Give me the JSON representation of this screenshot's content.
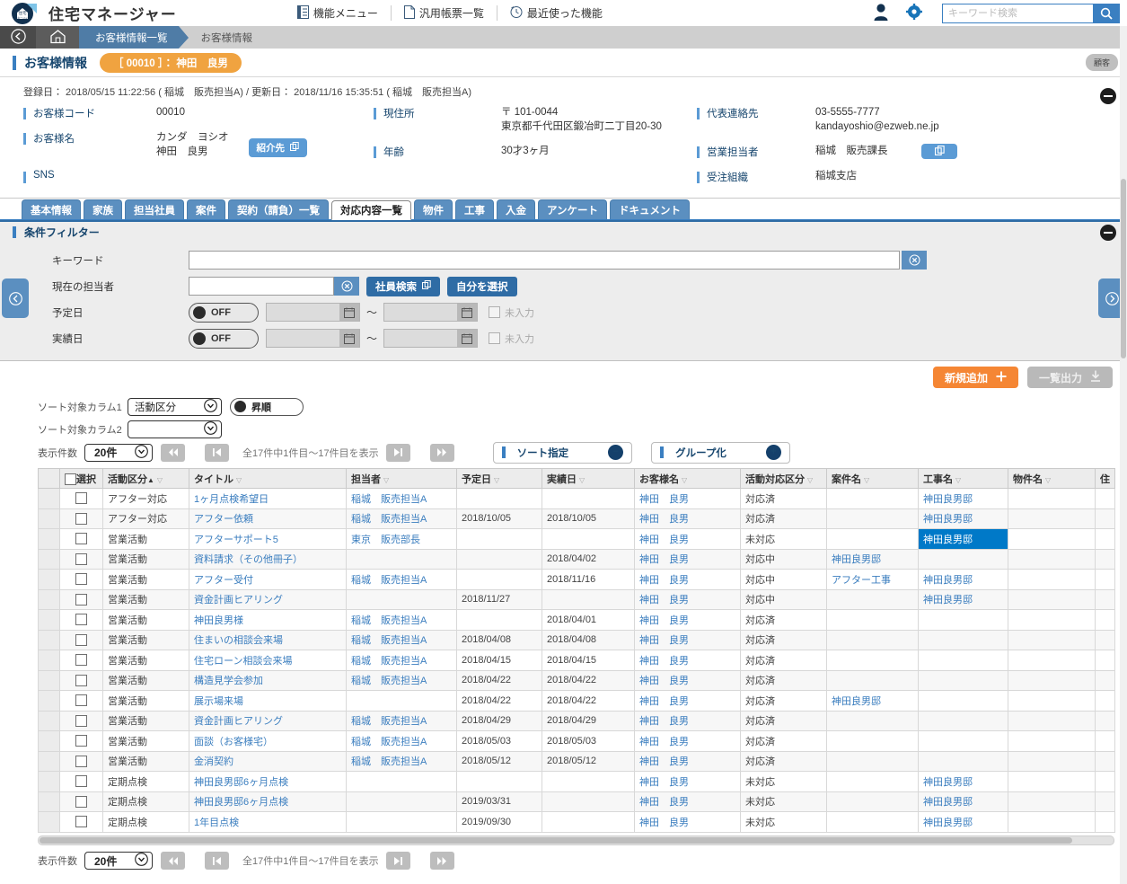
{
  "app": {
    "title": "住宅マネージャー",
    "logo_text": "住宅"
  },
  "header": {
    "menus": [
      {
        "label": "機能メニュー",
        "icon": "document-list-icon"
      },
      {
        "label": "汎用帳票一覧",
        "icon": "file-icon"
      },
      {
        "label": "最近使った機能",
        "icon": "clock-icon"
      }
    ],
    "person_icon": "person-icon",
    "gear_icon": "gear-icon",
    "search": {
      "placeholder": "キーワード検索",
      "value": "",
      "icon": "search-icon"
    }
  },
  "breadcrumb": {
    "back_icon": "back-arrow-icon",
    "home_icon": "home-icon",
    "items": [
      "お客様情報一覧"
    ],
    "current": "お客様情報"
  },
  "customer_header": {
    "title": "お客様情報",
    "badge": "［ 00010 ］： 神田　良男",
    "right_button": "顧客"
  },
  "info": {
    "registration_line": "登録日： 2018/05/15 11:22:56 ( 稲城　販売担当A) / 更新日： 2018/11/16 15:35:51 ( 稲城　販売担当A)",
    "collapse_icon": "minus-circle-icon",
    "fields": {
      "customer_code_label": "お客様コード",
      "customer_code_value": "00010",
      "customer_name_label": "お客様名",
      "customer_name_kana": "カンダ　ヨシオ",
      "customer_name_value": "神田　良男",
      "referral_button": "紹介先",
      "sns_label": "SNS",
      "address_label": "現住所",
      "address_postal": "〒 101-0044",
      "address_value": "東京都千代田区鍛冶町二丁目20-30",
      "age_label": "年齢",
      "age_value": "30才3ヶ月",
      "contact_label": "代表連絡先",
      "contact_tel": "03-5555-7777",
      "contact_mail": "kandayoshio@ezweb.ne.jp",
      "sales_rep_label": "営業担当者",
      "sales_rep_value": "稲城　販売課長",
      "org_label": "受注組織",
      "org_value": "稲城支店"
    }
  },
  "tabs": [
    {
      "label": "基本情報",
      "active": false
    },
    {
      "label": "家族",
      "active": false
    },
    {
      "label": "担当社員",
      "active": false
    },
    {
      "label": "案件",
      "active": false
    },
    {
      "label": "契約（請負）一覧",
      "active": false
    },
    {
      "label": "対応内容一覧",
      "active": true
    },
    {
      "label": "物件",
      "active": false
    },
    {
      "label": "工事",
      "active": false
    },
    {
      "label": "入金",
      "active": false
    },
    {
      "label": "アンケート",
      "active": false
    },
    {
      "label": "ドキュメント",
      "active": false
    }
  ],
  "filter": {
    "title": "条件フィルター",
    "collapse_icon": "minus-circle-icon",
    "keyword": {
      "label": "キーワード",
      "value": "",
      "clear_icon": "clear-circle-icon"
    },
    "current_rep": {
      "label": "現在の担当者",
      "value": "",
      "clear_icon": "clear-circle-icon",
      "search_button": "社員検索",
      "self_button": "自分を選択"
    },
    "planned_date": {
      "label": "予定日",
      "toggle": "OFF",
      "from": "",
      "to": "",
      "range_sep": "〜",
      "empty_label": "未入力"
    },
    "actual_date": {
      "label": "実績日",
      "toggle": "OFF",
      "from": "",
      "to": "",
      "range_sep": "〜",
      "empty_label": "未入力"
    }
  },
  "actions": {
    "add_label": "新規追加",
    "export_label": "一覧出力"
  },
  "sort": {
    "col1_label": "ソート対象カラム1",
    "col1_value": "活動区分",
    "order_label": "昇順",
    "col2_label": "ソート対象カラム2",
    "col2_value": "",
    "sort_spec_label": "ソート指定",
    "group_label": "グループ化"
  },
  "pagination": {
    "count_label": "表示件数",
    "page_size": "20件",
    "status": "全17件中1件目〜17件目を表示",
    "first_icon": "first-page-icon",
    "prev_icon": "prev-page-icon",
    "next_icon": "next-page-icon",
    "last_icon": "last-page-icon"
  },
  "table": {
    "columns": [
      {
        "label": "選択",
        "sort": "",
        "filter": false
      },
      {
        "label": "活動区分",
        "sort": "▲",
        "filter": true
      },
      {
        "label": "タイトル",
        "sort": "",
        "filter": true
      },
      {
        "label": "担当者",
        "sort": "",
        "filter": true
      },
      {
        "label": "予定日",
        "sort": "",
        "filter": true
      },
      {
        "label": "実績日",
        "sort": "",
        "filter": true
      },
      {
        "label": "お客様名",
        "sort": "",
        "filter": true
      },
      {
        "label": "活動対応区分",
        "sort": "",
        "filter": true
      },
      {
        "label": "案件名",
        "sort": "",
        "filter": true
      },
      {
        "label": "工事名",
        "sort": "",
        "filter": true
      },
      {
        "label": "物件名",
        "sort": "",
        "filter": true
      },
      {
        "label": "住",
        "sort": "",
        "filter": false
      }
    ],
    "rows": [
      {
        "category": "アフター対応",
        "title": "1ヶ月点検希望日",
        "rep": "稲城　販売担当A",
        "planned": "",
        "actual": "",
        "customer": "神田　良男",
        "status": "対応済",
        "project": "",
        "construction": "神田良男邸",
        "property": "",
        "selected_cell": ""
      },
      {
        "category": "アフター対応",
        "title": "アフター依頼",
        "rep": "稲城　販売担当A",
        "planned": "2018/10/05",
        "actual": "2018/10/05",
        "customer": "神田　良男",
        "status": "対応済",
        "project": "",
        "construction": "神田良男邸",
        "property": "",
        "selected_cell": ""
      },
      {
        "category": "営業活動",
        "title": "アフターサポート5",
        "rep": "東京　販売部長",
        "planned": "",
        "actual": "",
        "customer": "神田　良男",
        "status": "未対応",
        "project": "",
        "construction": "神田良男邸",
        "property": "",
        "selected_cell": "construction"
      },
      {
        "category": "営業活動",
        "title": "資料請求（その他冊子）",
        "rep": "",
        "planned": "",
        "actual": "2018/04/02",
        "customer": "神田　良男",
        "status": "対応中",
        "project": "神田良男邸",
        "construction": "",
        "property": "",
        "selected_cell": ""
      },
      {
        "category": "営業活動",
        "title": "アフター受付",
        "rep": "稲城　販売担当A",
        "planned": "",
        "actual": "2018/11/16",
        "customer": "神田　良男",
        "status": "対応中",
        "project": "アフター工事",
        "construction": "神田良男邸",
        "property": "",
        "selected_cell": ""
      },
      {
        "category": "営業活動",
        "title": "資金計画ヒアリング",
        "rep": "",
        "planned": "2018/11/27",
        "actual": "",
        "customer": "神田　良男",
        "status": "対応中",
        "project": "",
        "construction": "神田良男邸",
        "property": "",
        "selected_cell": ""
      },
      {
        "category": "営業活動",
        "title": "神田良男様",
        "rep": "稲城　販売担当A",
        "planned": "",
        "actual": "2018/04/01",
        "customer": "神田　良男",
        "status": "対応済",
        "project": "",
        "construction": "",
        "property": "",
        "selected_cell": ""
      },
      {
        "category": "営業活動",
        "title": "住まいの相談会来場",
        "rep": "稲城　販売担当A",
        "planned": "2018/04/08",
        "actual": "2018/04/08",
        "customer": "神田　良男",
        "status": "対応済",
        "project": "",
        "construction": "",
        "property": "",
        "selected_cell": ""
      },
      {
        "category": "営業活動",
        "title": "住宅ローン相談会来場",
        "rep": "稲城　販売担当A",
        "planned": "2018/04/15",
        "actual": "2018/04/15",
        "customer": "神田　良男",
        "status": "対応済",
        "project": "",
        "construction": "",
        "property": "",
        "selected_cell": ""
      },
      {
        "category": "営業活動",
        "title": "構造見学会参加",
        "rep": "稲城　販売担当A",
        "planned": "2018/04/22",
        "actual": "2018/04/22",
        "customer": "神田　良男",
        "status": "対応済",
        "project": "",
        "construction": "",
        "property": "",
        "selected_cell": ""
      },
      {
        "category": "営業活動",
        "title": "展示場来場",
        "rep": "",
        "planned": "2018/04/22",
        "actual": "2018/04/22",
        "customer": "神田　良男",
        "status": "対応済",
        "project": "神田良男邸",
        "construction": "",
        "property": "",
        "selected_cell": ""
      },
      {
        "category": "営業活動",
        "title": "資金計画ヒアリング",
        "rep": "稲城　販売担当A",
        "planned": "2018/04/29",
        "actual": "2018/04/29",
        "customer": "神田　良男",
        "status": "対応済",
        "project": "",
        "construction": "",
        "property": "",
        "selected_cell": ""
      },
      {
        "category": "営業活動",
        "title": "面談（お客様宅）",
        "rep": "稲城　販売担当A",
        "planned": "2018/05/03",
        "actual": "2018/05/03",
        "customer": "神田　良男",
        "status": "対応済",
        "project": "",
        "construction": "",
        "property": "",
        "selected_cell": ""
      },
      {
        "category": "営業活動",
        "title": "金消契約",
        "rep": "稲城　販売担当A",
        "planned": "2018/05/12",
        "actual": "2018/05/12",
        "customer": "神田　良男",
        "status": "対応済",
        "project": "",
        "construction": "",
        "property": "",
        "selected_cell": ""
      },
      {
        "category": "定期点検",
        "title": "神田良男邸6ヶ月点検",
        "rep": "",
        "planned": "",
        "actual": "",
        "customer": "神田　良男",
        "status": "未対応",
        "project": "",
        "construction": "神田良男邸",
        "property": "",
        "selected_cell": ""
      },
      {
        "category": "定期点検",
        "title": "神田良男邸6ヶ月点検",
        "rep": "",
        "planned": "2019/03/31",
        "actual": "",
        "customer": "神田　良男",
        "status": "未対応",
        "project": "",
        "construction": "神田良男邸",
        "property": "",
        "selected_cell": ""
      },
      {
        "category": "定期点検",
        "title": "1年目点検",
        "rep": "",
        "planned": "2019/09/30",
        "actual": "",
        "customer": "神田　良男",
        "status": "未対応",
        "project": "",
        "construction": "神田良男邸",
        "property": "",
        "selected_cell": ""
      }
    ]
  },
  "colors": {
    "brand_blue": "#2f6ca5",
    "accent_orange": "#f58634",
    "badge_orange": "#f0a340",
    "link_blue": "#3b7ebf",
    "selected_cell": "#0079c8"
  }
}
